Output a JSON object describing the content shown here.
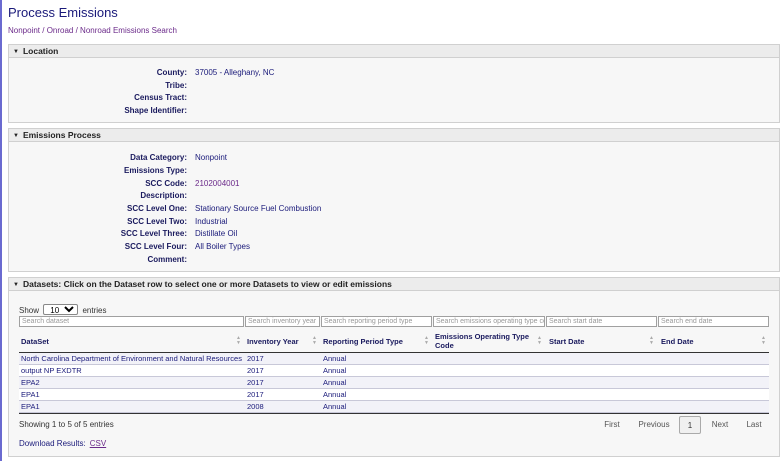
{
  "page": {
    "title": "Process Emissions",
    "breadcrumb": "Nonpoint / Onroad / Nonroad Emissions Search"
  },
  "location": {
    "header": "Location",
    "fields": [
      {
        "label": "County:",
        "value": "37005 - Alleghany, NC"
      },
      {
        "label": "Tribe:",
        "value": ""
      },
      {
        "label": "Census Tract:",
        "value": ""
      },
      {
        "label": "Shape Identifier:",
        "value": ""
      }
    ]
  },
  "process": {
    "header": "Emissions Process",
    "fields": [
      {
        "label": "Data Category:",
        "value": "Nonpoint"
      },
      {
        "label": "Emissions Type:",
        "value": ""
      },
      {
        "label": "SCC Code:",
        "value": "2102004001"
      },
      {
        "label": "Description:",
        "value": ""
      },
      {
        "label": "SCC Level One:",
        "value": "Stationary Source Fuel Combustion"
      },
      {
        "label": "SCC Level Two:",
        "value": "Industrial"
      },
      {
        "label": "SCC Level Three:",
        "value": "Distillate Oil"
      },
      {
        "label": "SCC Level Four:",
        "value": "All Boiler Types"
      },
      {
        "label": "Comment:",
        "value": ""
      }
    ]
  },
  "datasets": {
    "header": "Datasets: Click on the Dataset row to select one or more Datasets to view or edit emissions",
    "show_label": "Show",
    "show_value": "10",
    "entries_label": "entries",
    "filters": [
      "Search dataset",
      "Search inventory year",
      "Search reporting period type",
      "Search emissions operating type code",
      "Search start date",
      "Search end date"
    ],
    "columns": [
      "DataSet",
      "Inventory Year",
      "Reporting Period Type",
      "Emissions Operating Type Code",
      "Start Date",
      "End Date"
    ],
    "rows": [
      {
        "dataset": "North Carolina Department of Environment and Natural Resources",
        "year": "2017",
        "period": "Annual",
        "op": "",
        "start": "",
        "end": ""
      },
      {
        "dataset": "output NP EXDTR",
        "year": "2017",
        "period": "Annual",
        "op": "",
        "start": "",
        "end": ""
      },
      {
        "dataset": "EPA2",
        "year": "2017",
        "period": "Annual",
        "op": "",
        "start": "",
        "end": ""
      },
      {
        "dataset": "EPA1",
        "year": "2017",
        "period": "Annual",
        "op": "",
        "start": "",
        "end": ""
      },
      {
        "dataset": "EPA1",
        "year": "2008",
        "period": "Annual",
        "op": "",
        "start": "",
        "end": ""
      }
    ],
    "info": "Showing 1 to 5 of 5 entries",
    "pager": {
      "first": "First",
      "previous": "Previous",
      "current": "1",
      "next": "Next",
      "last": "Last"
    },
    "download_label": "Download Results:",
    "csv_label": "CSV"
  }
}
